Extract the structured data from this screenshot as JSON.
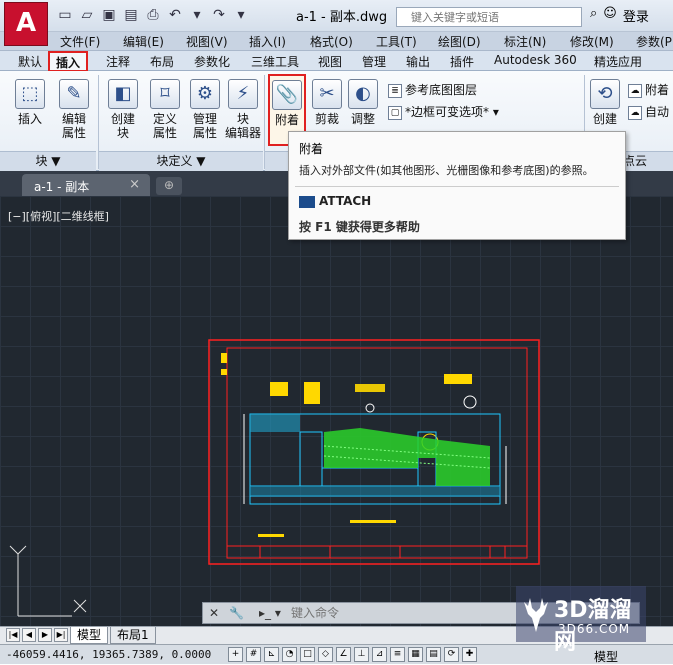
{
  "app": {
    "logo": "A",
    "document_title": "a-1 - 副本.dwg"
  },
  "search": {
    "placeholder": "键入关键字或短语"
  },
  "account": {
    "login": "登录"
  },
  "menubar": [
    "文件(F)",
    "编辑(E)",
    "视图(V)",
    "插入(I)",
    "格式(O)",
    "工具(T)",
    "绘图(D)",
    "标注(N)",
    "修改(M)",
    "参数(P"
  ],
  "ribbon_tabs": [
    "默认",
    "插入",
    "注释",
    "布局",
    "参数化",
    "三维工具",
    "视图",
    "管理",
    "输出",
    "插件",
    "Autodesk 360",
    "精选应用"
  ],
  "ribbon": {
    "insert": "插入",
    "edit_attr_1": "编辑",
    "edit_attr_2": "属性",
    "create_block_1": "创建",
    "create_block_2": "块",
    "define_attr_1": "定义",
    "define_attr_2": "属性",
    "manage_attr_1": "管理",
    "manage_attr_2": "属性",
    "block_editor_1": "块",
    "block_editor_2": "编辑器",
    "attach": "附着",
    "clip": "剪裁",
    "adjust": "调整",
    "underlay_layers": "参考底图图层",
    "frame_variable": "*边框可变选项*",
    "create": "创建",
    "attach2": "附着",
    "auto": "自动",
    "panel_block": "块 ▼",
    "panel_block_def": "块定义 ▼",
    "panel_pointcloud": "点云"
  },
  "tooltip": {
    "title": "附着",
    "description": "插入对外部文件(如其他图形、光栅图像和参考底图)的参照。",
    "command": "ATTACH",
    "help": "按 F1 键获得更多帮助"
  },
  "document_tabs": [
    {
      "label": "a-1 - 副本"
    }
  ],
  "viewport_label": "[−][俯视][二维线框]",
  "command": {
    "placeholder": "键入命令"
  },
  "layout_tabs": [
    "模型",
    "布局1"
  ],
  "status": {
    "coordinates": "-46059.4416, 19365.7389, 0.0000",
    "mode": "模型"
  },
  "watermark": {
    "title": "3D溜溜网",
    "url": "3D66.COM"
  },
  "colors": {
    "logo_red": "#c8102e",
    "highlight_red": "#e02020",
    "canvas_bg": "#212830",
    "hatch_green": "#2ad22a",
    "drawing_yellow": "#ffd800"
  }
}
